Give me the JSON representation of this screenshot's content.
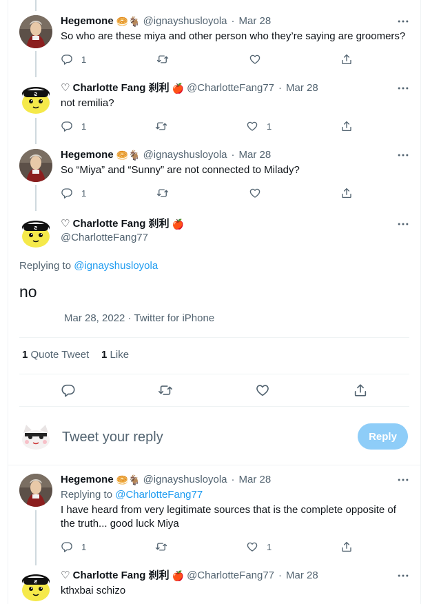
{
  "colors": {
    "accent": "#1d9bf0",
    "text": "#0f1419",
    "muted": "#536471",
    "like_icon": "#536471",
    "reply_button_bg": "#8ecdf8"
  },
  "users": {
    "hegemone": {
      "name": "Hegemone",
      "emoji": "🥯🐐",
      "handle": "@ignayshusloyola"
    },
    "charlotte": {
      "name": "♡ Charlotte Fang 刹利",
      "emoji": "🍎",
      "handle": "@CharlotteFang77"
    }
  },
  "tweets": [
    {
      "date": "Mar 28",
      "text": "So who are these miya and other person who they’re saying are groomers?",
      "replies": "1",
      "retweets": "",
      "likes": ""
    },
    {
      "date": "Mar 28",
      "text": "not remilia?",
      "replies": "1",
      "retweets": "",
      "likes": "1"
    },
    {
      "date": "Mar 28",
      "text": "So “Miya” and “Sunny” are not connected to Milady?",
      "replies": "1",
      "retweets": "",
      "likes": ""
    }
  ],
  "main_tweet": {
    "replying_prefix": "Replying to",
    "replying_handle": "@ignayshusloyola",
    "text": "no",
    "meta": "Mar 28, 2022 · Twitter for iPhone",
    "quote_count": "1",
    "quote_label": "Quote Tweet",
    "like_count": "1",
    "like_label": "Like"
  },
  "composer": {
    "placeholder": "Tweet your reply",
    "button": "Reply"
  },
  "replies": [
    {
      "date": "Mar 28",
      "replying_prefix": "Replying to",
      "replying_handle": "@CharlotteFang77",
      "text": "I have heard from very legitimate sources that is the complete opposite of the truth... good luck Miya",
      "replies": "1",
      "retweets": "",
      "likes": "1"
    },
    {
      "date": "Mar 28",
      "text": "kthxbai schizo"
    }
  ],
  "icons": [
    "reply-icon",
    "retweet-icon",
    "like-icon",
    "share-icon",
    "more-icon"
  ]
}
